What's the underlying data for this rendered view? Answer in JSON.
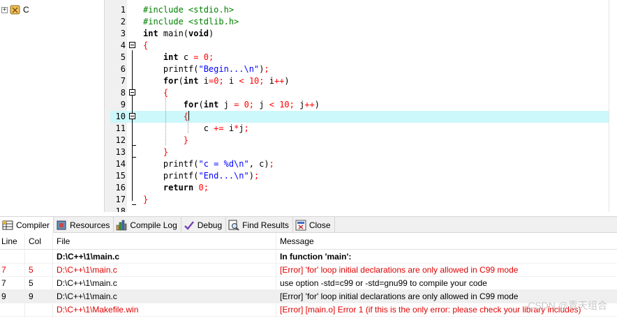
{
  "project_tree": {
    "project_name": "C"
  },
  "editor": {
    "cursor_line": 10,
    "lines": [
      {
        "n": "1",
        "html": "<span class='pp'>#include &lt;stdio.h&gt;</span>"
      },
      {
        "n": "2",
        "html": "<span class='pp'>#include &lt;stdlib.h&gt;</span>"
      },
      {
        "n": "3",
        "html": "<span class='kw'>int</span> main(<span class='kw'>void</span>)"
      },
      {
        "n": "4",
        "html": "<span class='brace'>{</span>"
      },
      {
        "n": "5",
        "html": "    <span class='kw'>int</span> c <span class='sym'>=</span> <span class='num'>0</span><span class='sym'>;</span>"
      },
      {
        "n": "6",
        "html": "    printf(<span class='str'>\"Begin...\\n\"</span>)<span class='sym'>;</span>"
      },
      {
        "n": "7",
        "html": "    <span class='kw'>for</span>(<span class='kw'>int</span> i<span class='sym'>=</span><span class='num'>0</span><span class='sym'>;</span> i <span class='sym'>&lt;</span> <span class='num'>10</span><span class='sym'>;</span> i<span class='sym'>++</span>)"
      },
      {
        "n": "8",
        "html": "    <span class='brace'>{</span>"
      },
      {
        "n": "9",
        "html": "        <span class='kw'>for</span>(<span class='kw'>int</span> j <span class='sym'>=</span> <span class='num'>0</span><span class='sym'>;</span> j <span class='sym'>&lt;</span> <span class='num'>10</span><span class='sym'>;</span> j<span class='sym'>++</span>)"
      },
      {
        "n": "10",
        "html": "        <span class='brace'>{</span><span class='cursor'></span>"
      },
      {
        "n": "11",
        "html": "            c <span class='sym'>+=</span> i<span class='sym'>*</span>j<span class='sym'>;</span>"
      },
      {
        "n": "12",
        "html": "        <span class='brace'>}</span>"
      },
      {
        "n": "13",
        "html": "    <span class='brace'>}</span>"
      },
      {
        "n": "14",
        "html": "    printf(<span class='str'>\"c = %d\\n\"</span>, c)<span class='sym'>;</span>"
      },
      {
        "n": "15",
        "html": "    printf(<span class='str'>\"End...\\n\"</span>)<span class='sym'>;</span>"
      },
      {
        "n": "16",
        "html": "    <span class='kw'>return</span> <span class='num'>0</span><span class='sym'>;</span>"
      },
      {
        "n": "17",
        "html": "<span class='brace'>}</span>"
      },
      {
        "n": "18",
        "html": ""
      }
    ]
  },
  "tabs": [
    {
      "label": "Compiler",
      "icon": "compiler-grid-icon",
      "active": true
    },
    {
      "label": "Resources",
      "icon": "resources-icon",
      "active": false
    },
    {
      "label": "Compile Log",
      "icon": "compile-log-bars-icon",
      "active": false
    },
    {
      "label": "Debug",
      "icon": "debug-check-icon",
      "active": false
    },
    {
      "label": "Find Results",
      "icon": "find-results-icon",
      "active": false
    },
    {
      "label": "Close",
      "icon": "close-icon",
      "active": false
    }
  ],
  "messages": {
    "headers": {
      "line": "Line",
      "col": "Col",
      "file": "File",
      "message": "Message"
    },
    "rows": [
      {
        "line": "",
        "col": "",
        "file": "D:\\C++\\1\\main.c",
        "message": "In function 'main':",
        "style": "bold"
      },
      {
        "line": "7",
        "col": "5",
        "file": "D:\\C++\\1\\main.c",
        "message": "[Error] 'for' loop initial declarations are only allowed in C99 mode",
        "style": "red"
      },
      {
        "line": "7",
        "col": "5",
        "file": "D:\\C++\\1\\main.c",
        "message": "use option -std=c99 or -std=gnu99 to compile your code",
        "style": "normal"
      },
      {
        "line": "9",
        "col": "9",
        "file": "D:\\C++\\1\\main.c",
        "message": "[Error] 'for' loop initial declarations are only allowed in C99 mode",
        "style": "selected"
      },
      {
        "line": "",
        "col": "",
        "file": "D:\\C++\\1\\Makefile.win",
        "message": "[Error] [main.o] Error 1 (if this is the only error: please check your library includes)",
        "style": "red"
      }
    ]
  },
  "watermark": "CSDN @青天组合",
  "colors": {
    "active_line": "#ccf7fb",
    "error_text": "#e00000",
    "preprocessor": "#008000",
    "string": "#0000ff"
  }
}
